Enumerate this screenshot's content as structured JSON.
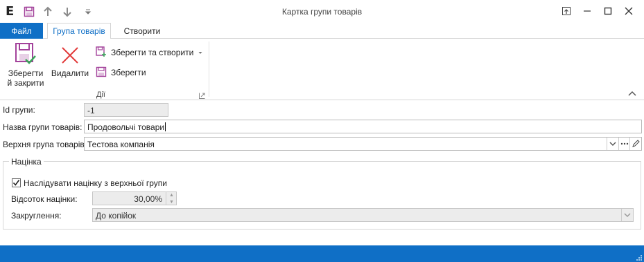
{
  "window": {
    "app_logo": "E",
    "title": "Картка групи товарів"
  },
  "quick_access": [
    "save-icon",
    "arrow-up-icon",
    "arrow-down-icon",
    "customize-dropdown-icon"
  ],
  "tabs": {
    "file": "Файл",
    "product_group": "Група товарів",
    "create": "Створити"
  },
  "ribbon": {
    "save_close": "Зберегти й закрити",
    "delete": "Видалити",
    "save_create": "Зберегти та створити",
    "save": "Зберегти",
    "group_actions": "Дії"
  },
  "form": {
    "id_label": "Id групи:",
    "id_value": "-1",
    "name_label": "Назва групи товарів:",
    "name_value": "Продовольчі товари",
    "parent_label": "Верхня група товарів:",
    "parent_value": "Тестова компанія"
  },
  "markup": {
    "title": "Націнка",
    "inherit_label": "Наслідувати націнку з верхньої групи",
    "inherit_checked": true,
    "percent_label": "Відсоток націнки:",
    "percent_value": "30,00%",
    "rounding_label": "Закруглення:",
    "rounding_value": "До копійок"
  },
  "colors": {
    "accent": "#0f6fc6",
    "save_icon": "#a3429b",
    "delete_icon": "#e23b3b",
    "check": "#3aa55a"
  }
}
